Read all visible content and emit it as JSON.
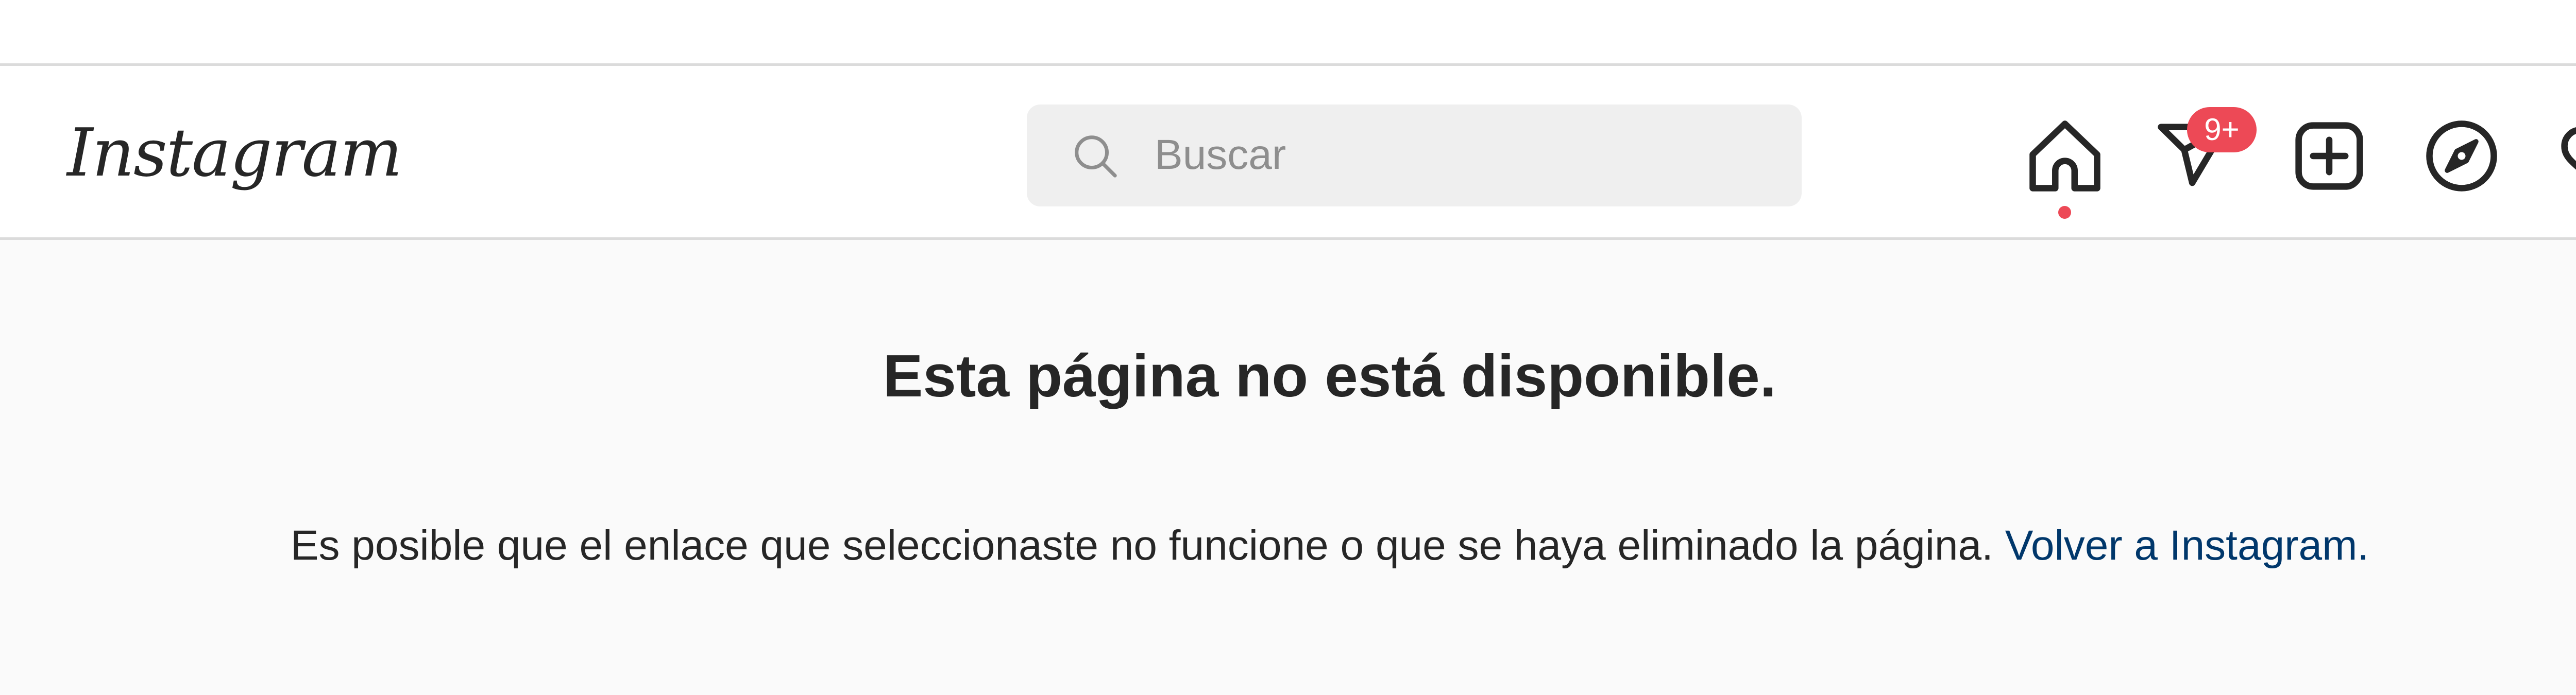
{
  "header": {
    "logo_text": "Instagram",
    "search": {
      "placeholder": "Buscar",
      "value": ""
    },
    "nav": {
      "home_icon": "home-icon",
      "direct_icon": "direct-message-icon",
      "direct_badge": "9+",
      "new_post_icon": "new-post-icon",
      "explore_icon": "explore-compass-icon",
      "activity_icon": "heart-icon"
    }
  },
  "main": {
    "title": "Esta página no está disponible.",
    "message": "Es posible que el enlace que seleccionaste no funcione o que se haya eliminado la página.",
    "link_label": "Volver a Instagram."
  },
  "colors": {
    "badge": "#ed4956",
    "text": "#262626",
    "link": "#00376b",
    "background": "#fafafa"
  }
}
